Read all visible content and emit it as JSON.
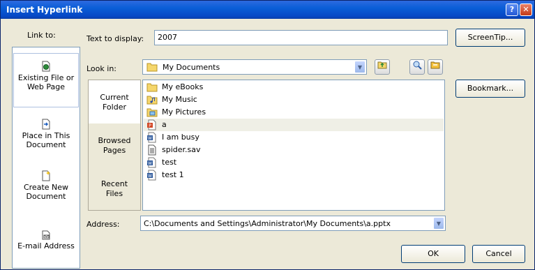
{
  "window": {
    "title": "Insert Hyperlink",
    "help_glyph": "?",
    "close_glyph": "✕",
    "colors": {
      "title_bar": "#0a5ed7",
      "dialog_bg": "#ece9d8",
      "border_blue": "#7f9db9"
    }
  },
  "link_to": {
    "label": "Link to:",
    "items": [
      {
        "line1": "Existing File or",
        "line2": "Web Page",
        "icon": "document-globe-icon",
        "selected": true
      },
      {
        "line1": "Place in This",
        "line2": "Document",
        "icon": "document-arrow-icon",
        "selected": false
      },
      {
        "line1": "Create New",
        "line2": "Document",
        "icon": "new-document-icon",
        "selected": false
      },
      {
        "line1": "E-mail Address",
        "line2": "",
        "icon": "email-icon",
        "selected": false
      }
    ]
  },
  "text_to_display": {
    "label": "Text to display:",
    "value": "2007"
  },
  "screentip_button": "ScreenTip...",
  "look_in": {
    "label": "Look in:",
    "value": "My Documents"
  },
  "toolbar_icons": [
    "up-folder-icon",
    "browse-web-icon",
    "browse-file-icon"
  ],
  "nav": {
    "current_folder": {
      "line1": "Current",
      "line2": "Folder"
    },
    "browsed_pages": {
      "line1": "Browsed",
      "line2": "Pages"
    },
    "recent_files": {
      "line1": "Recent",
      "line2": "Files"
    }
  },
  "bookmark_button": "Bookmark...",
  "files": [
    {
      "name": "My eBooks",
      "icon": "folder-icon"
    },
    {
      "name": "My Music",
      "icon": "music-folder-icon"
    },
    {
      "name": "My Pictures",
      "icon": "pictures-folder-icon"
    },
    {
      "name": "a",
      "icon": "ppt-file-icon",
      "selected": true
    },
    {
      "name": "I am busy",
      "icon": "word-file-icon"
    },
    {
      "name": "spider.sav",
      "icon": "generic-file-icon"
    },
    {
      "name": "test",
      "icon": "word-file-icon"
    },
    {
      "name": "test 1",
      "icon": "word-file-icon"
    }
  ],
  "address": {
    "label": "Address:",
    "value": "C:\\Documents and Settings\\Administrator\\My Documents\\a.pptx"
  },
  "ok_button": "OK",
  "cancel_button": "Cancel"
}
